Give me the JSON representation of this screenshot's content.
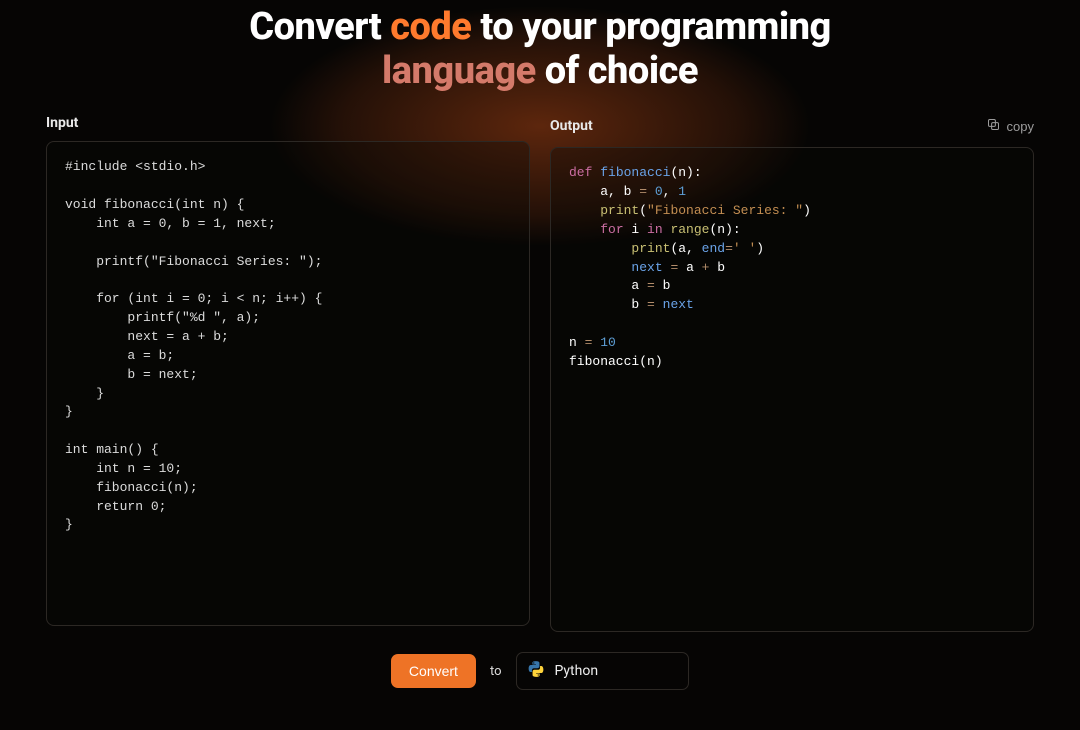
{
  "hero": {
    "prefix": "Convert ",
    "code_word": "code",
    "mid": " to your programming",
    "language_word": "language",
    "suffix": " of choice"
  },
  "input": {
    "label": "Input",
    "code_lines": [
      "#include <stdio.h>",
      "",
      "void fibonacci(int n) {",
      "    int a = 0, b = 1, next;",
      "",
      "    printf(\"Fibonacci Series: \");",
      "",
      "    for (int i = 0; i < n; i++) {",
      "        printf(\"%d \", a);",
      "        next = a + b;",
      "        a = b;",
      "        b = next;",
      "    }",
      "}",
      "",
      "int main() {",
      "    int n = 10;",
      "    fibonacci(n);",
      "    return 0;",
      "}"
    ]
  },
  "output": {
    "label": "Output",
    "copy_label": "copy",
    "tokens": [
      [
        [
          "kw",
          "def"
        ],
        [
          "c-white",
          " "
        ],
        [
          "fn",
          "fibonacci"
        ],
        [
          "c-white",
          "(n):"
        ]
      ],
      [
        [
          "c-white",
          "    a, b "
        ],
        [
          "assign",
          "="
        ],
        [
          "c-white",
          " "
        ],
        [
          "num",
          "0"
        ],
        [
          "c-white",
          ", "
        ],
        [
          "num",
          "1"
        ]
      ],
      [
        [
          "c-white",
          "    "
        ],
        [
          "bi",
          "print"
        ],
        [
          "c-white",
          "("
        ],
        [
          "str",
          "\"Fibonacci Series: \""
        ],
        [
          "c-white",
          ")"
        ]
      ],
      [
        [
          "c-white",
          "    "
        ],
        [
          "kw",
          "for"
        ],
        [
          "c-white",
          " i "
        ],
        [
          "kw",
          "in"
        ],
        [
          "c-white",
          " "
        ],
        [
          "bi",
          "range"
        ],
        [
          "c-white",
          "(n):"
        ]
      ],
      [
        [
          "c-white",
          "        "
        ],
        [
          "bi",
          "print"
        ],
        [
          "c-white",
          "(a, "
        ],
        [
          "fn",
          "end"
        ],
        [
          "assign",
          "="
        ],
        [
          "str",
          "' '"
        ],
        [
          "c-white",
          ")"
        ]
      ],
      [
        [
          "c-white",
          "        "
        ],
        [
          "fn",
          "next"
        ],
        [
          "c-white",
          " "
        ],
        [
          "assign",
          "="
        ],
        [
          "c-white",
          " a "
        ],
        [
          "assign",
          "+"
        ],
        [
          "c-white",
          " b"
        ]
      ],
      [
        [
          "c-white",
          "        a "
        ],
        [
          "assign",
          "="
        ],
        [
          "c-white",
          " b"
        ]
      ],
      [
        [
          "c-white",
          "        b "
        ],
        [
          "assign",
          "="
        ],
        [
          "c-white",
          " "
        ],
        [
          "fn",
          "next"
        ]
      ],
      [
        [
          "c-white",
          ""
        ]
      ],
      [
        [
          "c-white",
          "n "
        ],
        [
          "assign",
          "="
        ],
        [
          "c-white",
          " "
        ],
        [
          "num",
          "10"
        ]
      ],
      [
        [
          "c-white",
          "fibonacci(n)"
        ]
      ]
    ]
  },
  "action": {
    "convert_label": "Convert",
    "to_label": "to",
    "language_selected": "Python"
  }
}
